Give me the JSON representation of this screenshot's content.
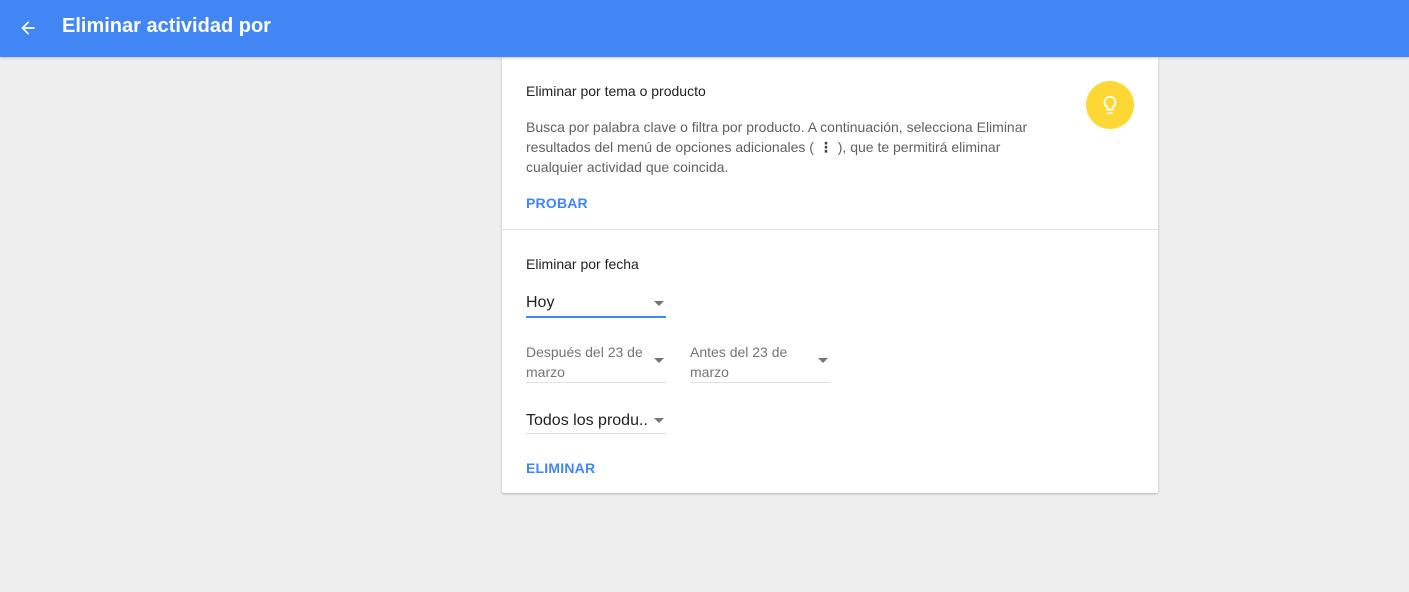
{
  "header": {
    "title": "Eliminar actividad por",
    "back_icon": "arrow-back-icon",
    "color": "#4285f4"
  },
  "topic_section": {
    "title": "Eliminar por tema o producto",
    "desc_part1": "Busca por palabra clave o filtra por producto. A continuación, selecciona Eliminar resultados del menú de opciones adicionales (",
    "menu_glyph": "⋮",
    "desc_part2": "), que te permitirá eliminar cualquier actividad que coincida.",
    "hint_icon": "lightbulb-icon",
    "hint_color": "#fdd835",
    "try_label": "PROBAR"
  },
  "date_section": {
    "title": "Eliminar por fecha",
    "range_select": "Hoy",
    "after_select": "Después del 23 de marzo",
    "before_select": "Antes del 23 de marzo",
    "products_select": "Todos los produ..",
    "delete_label": "ELIMINAR"
  },
  "accent_color": "#4285f4"
}
